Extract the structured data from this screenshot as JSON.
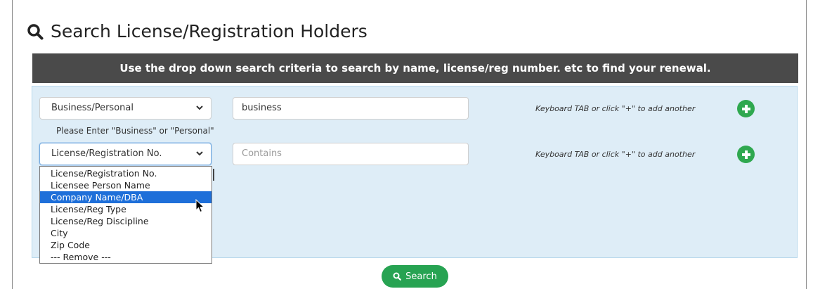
{
  "header": {
    "title": "Search License/Registration Holders"
  },
  "banner": {
    "text": "Use the drop down search criteria to search by name, license/reg number. etc to find your renewal."
  },
  "rows": [
    {
      "field": "Business/Personal",
      "value": "business",
      "hint": "Keyboard TAB or click \"+\" to add another",
      "note": "Please Enter \"Business\" or \"Personal\""
    },
    {
      "field": "License/Registration No.",
      "placeholder": "Contains",
      "hint": "Keyboard TAB or click \"+\" to add another"
    }
  ],
  "dropdown": {
    "options": [
      "License/Registration No.",
      "Licensee Person Name",
      "Company Name/DBA",
      "License/Reg Type",
      "License/Reg Discipline",
      "City",
      "Zip Code",
      "--- Remove ---"
    ],
    "highlighted": "Company Name/DBA"
  },
  "search_button": {
    "label": "Search"
  },
  "colors": {
    "banner": "#4a4a4a",
    "panel": "#deedf7",
    "accent_green": "#27a352",
    "highlight": "#1e6fd9"
  }
}
